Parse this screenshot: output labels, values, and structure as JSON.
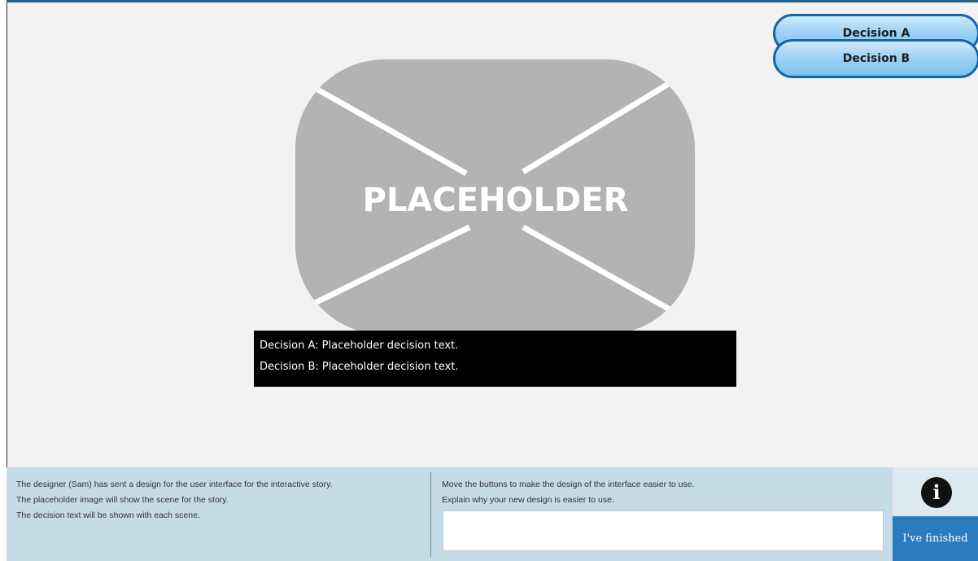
{
  "stage": {
    "decision_buttons": [
      {
        "label": "Decision A"
      },
      {
        "label": "Decision B"
      }
    ],
    "placeholder_image": {
      "label": "PLACEHOLDER",
      "fill_color": "#b3b3b3",
      "cross_color": "#ffffff"
    },
    "decision_text": [
      "Decision A: Placeholder decision text.",
      "Decision B: Placeholder decision text."
    ]
  },
  "footer": {
    "instructions_left": [
      "The designer (Sam) has sent a design for the user interface for the interactive story.",
      "The placeholder image will show the scene for the story.",
      "The decision text will be shown with each scene."
    ],
    "instructions_right": [
      "Move the buttons to make the design of the interface easier to use.",
      "Explain why your new design is easier to use."
    ],
    "answer_value": "",
    "info_icon": "info-icon",
    "finished_label": "I've finished"
  },
  "colors": {
    "accent": "#1f5f86",
    "footer_bg": "#c3dce6",
    "finished_btn": "#2a7bbf"
  }
}
